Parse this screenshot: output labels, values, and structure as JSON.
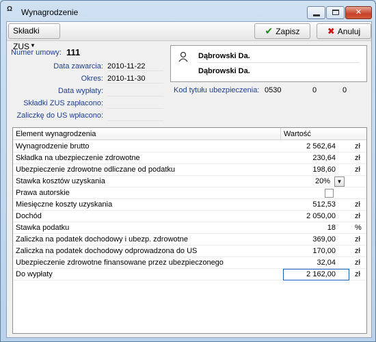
{
  "window": {
    "icon": "app-icon",
    "title": "Wynagrodzenie",
    "min_label": "",
    "max_label": "",
    "close_label": "✕"
  },
  "toolbar": {
    "skladki_label": "Składki ZUS",
    "zapisz_label": "Zapisz",
    "anuluj_label": "Anuluj"
  },
  "form": {
    "numer_umowy_label": "Numer umowy:",
    "numer_umowy_value": "111",
    "data_zawarcia_label": "Data zawarcia:",
    "data_zawarcia_value": "2010-11-22",
    "okres_label": "Okres:",
    "okres_value": "2010-11-30",
    "data_wyplaty_label": "Data wypłaty:",
    "data_wyplaty_value": "",
    "skladki_zaplacono_label": "Składki ZUS zapłacono:",
    "skladki_zaplacono_value": "",
    "zaliczke_label": "Zaliczkę do US wpłacono:",
    "zaliczke_value": ""
  },
  "party": {
    "line1": "Dąbrowski Da.",
    "line2": "Dąbrowski Da."
  },
  "kod": {
    "label": "Kod tytułu ubezpieczenia:",
    "v1": "0530",
    "v2": "0",
    "v3": "0"
  },
  "grid": {
    "col_element": "Element wynagrodzenia",
    "col_wartosc": "Wartość",
    "rows": [
      {
        "name": "Wynagrodzenie brutto",
        "value": "2 562,64",
        "unit": "zł"
      },
      {
        "name": "Składka na ubezpieczenie zdrowotne",
        "value": "230,64",
        "unit": "zł"
      },
      {
        "name": "Ubezpieczenie zdrowotne odliczane od podatku",
        "value": "198,60",
        "unit": "zł"
      },
      {
        "name": "Stawka kosztów uzyskania",
        "value": "20%",
        "unit": ""
      },
      {
        "name": "Prawa autorskie",
        "value": "",
        "unit": ""
      },
      {
        "name": "Miesięczne koszty uzyskania",
        "value": "512,53",
        "unit": "zł"
      },
      {
        "name": "Dochód",
        "value": "2 050,00",
        "unit": "zł"
      },
      {
        "name": "Stawka podatku",
        "value": "18",
        "unit": "%"
      },
      {
        "name": "Zaliczka na podatek dochodowy i ubezp. zdrowotne",
        "value": "369,00",
        "unit": "zł"
      },
      {
        "name": "Zaliczka na podatek dochodowy odprowadzona do US",
        "value": "170,00",
        "unit": "zł"
      },
      {
        "name": "Ubezpieczenie zdrowotne finansowane przez ubezpieczonego",
        "value": "32,04",
        "unit": "zł"
      },
      {
        "name": "Do wypłaty",
        "value": "2 162,00",
        "unit": "zł"
      }
    ]
  }
}
